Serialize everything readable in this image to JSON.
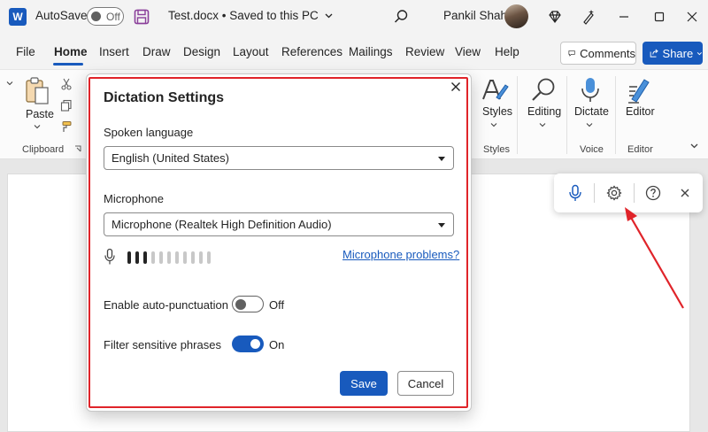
{
  "titlebar": {
    "app_logo_letter": "W",
    "autosave_label": "AutoSave",
    "autosave_state": "Off",
    "doc_title": "Test.docx • Saved to this PC",
    "user_name": "Pankil Shah"
  },
  "menu": {
    "items": [
      "File",
      "Home",
      "Insert",
      "Draw",
      "Design",
      "Layout",
      "References",
      "Mailings",
      "Review",
      "View",
      "Help"
    ],
    "active": "Home",
    "comments_label": "Comments",
    "share_label": "Share"
  },
  "ribbon": {
    "paste_label": "Paste",
    "clipboard_group": "Clipboard",
    "styles_label": "Styles",
    "styles_group": "Styles",
    "editing_label": "Editing",
    "dictate_label": "Dictate",
    "voice_group": "Voice",
    "editor_label": "Editor",
    "editor_group": "Editor"
  },
  "dialog": {
    "title": "Dictation Settings",
    "language_label": "Spoken language",
    "language_value": "English (United States)",
    "microphone_label": "Microphone",
    "microphone_value": "Microphone (Realtek High Definition Audio)",
    "mic_problems_link": "Microphone problems?",
    "auto_punct_label": "Enable auto-punctuation",
    "auto_punct_state": "Off",
    "filter_label": "Filter sensitive phrases",
    "filter_state": "On",
    "save_label": "Save",
    "cancel_label": "Cancel",
    "mic_level_active_bars": 3,
    "mic_level_total_bars": 11
  },
  "colors": {
    "accent": "#185abd",
    "highlight": "#e0242a"
  },
  "icons": [
    "word-icon",
    "save-icon",
    "search-icon",
    "diamond-icon",
    "designer-icon",
    "minimize-icon",
    "maximize-icon",
    "close-icon",
    "comment-icon",
    "share-icon",
    "paste-icon",
    "cut-icon",
    "copy-icon",
    "format-painter-icon",
    "styles-icon",
    "editing-icon",
    "dictate-mic-icon",
    "editor-icon",
    "microphone-icon",
    "settings-gear-icon",
    "help-icon"
  ]
}
